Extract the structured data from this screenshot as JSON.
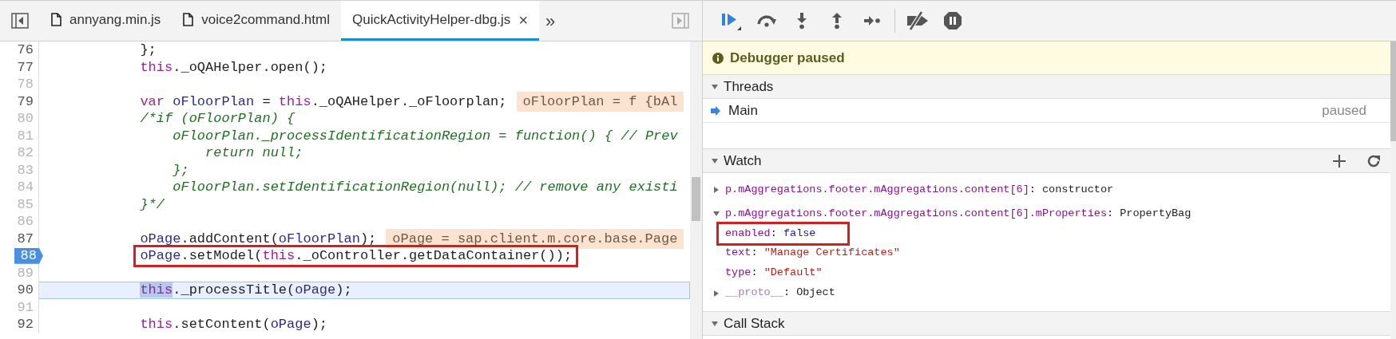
{
  "tabs": [
    {
      "label": "annyang.min.js",
      "selected": false,
      "closable": false
    },
    {
      "label": "voice2command.html",
      "selected": false,
      "closable": false
    },
    {
      "label": "QuickActivityHelper-dbg.js",
      "selected": true,
      "closable": true
    }
  ],
  "close_glyph": "×",
  "overflow_glyph": "»",
  "code_lines": [
    {
      "number": "76",
      "executable": true,
      "current": false,
      "selected": false,
      "annotated": false,
      "tokens": [
        {
          "text": "            };",
          "kind": "plain"
        }
      ]
    },
    {
      "number": "77",
      "executable": true,
      "current": false,
      "selected": false,
      "annotated": false,
      "tokens": [
        {
          "text": "            this",
          "kind": "keyword"
        },
        {
          "text": "._oQAHelper.open();",
          "kind": "plain"
        }
      ]
    },
    {
      "number": "78",
      "executable": false,
      "current": false,
      "selected": false,
      "annotated": false
    },
    {
      "number": "79",
      "executable": true,
      "current": false,
      "selected": false,
      "annotated": false,
      "tokens": [
        {
          "text": "            var",
          "kind": "keyword"
        },
        {
          "text": " oFloorPlan",
          "kind": "variable"
        },
        {
          "text": " = ",
          "kind": "plain"
        },
        {
          "text": "this",
          "kind": "keyword"
        },
        {
          "text": "._oQAHelper._oFloorplan;",
          "kind": "plain"
        }
      ],
      "inline_value": "oFloorPlan = f {bAl"
    },
    {
      "number": "80",
      "executable": false,
      "current": false,
      "selected": false,
      "annotated": false,
      "tokens": [
        {
          "text": "            /*if (oFloorPlan) {",
          "kind": "comment"
        }
      ]
    },
    {
      "number": "81",
      "executable": false,
      "current": false,
      "selected": false,
      "annotated": false,
      "tokens": [
        {
          "text": "                oFloorPlan._processIdentificationRegion = function() { // Prev",
          "kind": "comment"
        }
      ]
    },
    {
      "number": "82",
      "executable": false,
      "current": false,
      "selected": false,
      "annotated": false,
      "tokens": [
        {
          "text": "                    return null;",
          "kind": "comment"
        }
      ]
    },
    {
      "number": "83",
      "executable": false,
      "current": false,
      "selected": false,
      "annotated": false,
      "tokens": [
        {
          "text": "                };",
          "kind": "comment"
        }
      ]
    },
    {
      "number": "84",
      "executable": false,
      "current": false,
      "selected": false,
      "annotated": false,
      "tokens": [
        {
          "text": "                oFloorPlan.setIdentificationRegion(null); // remove any existi",
          "kind": "comment"
        }
      ]
    },
    {
      "number": "85",
      "executable": false,
      "current": false,
      "selected": false,
      "annotated": false,
      "tokens": [
        {
          "text": "            }*/",
          "kind": "comment"
        }
      ]
    },
    {
      "number": "86",
      "executable": false,
      "current": false,
      "selected": false,
      "annotated": false
    },
    {
      "number": "87",
      "executable": true,
      "current": false,
      "selected": false,
      "annotated": false,
      "tokens": [
        {
          "text": "            oPage",
          "kind": "variable"
        },
        {
          "text": ".addContent(",
          "kind": "plain"
        },
        {
          "text": "oFloorPlan",
          "kind": "variable"
        },
        {
          "text": ");",
          "kind": "plain"
        }
      ],
      "inline_value": "oPage = sap.client.m.core.base.Page"
    },
    {
      "number": "88",
      "executable": true,
      "current": true,
      "selected": false,
      "annotated": true,
      "tokens": [
        {
          "text": "oPage",
          "kind": "variable"
        },
        {
          "text": ".setModel(",
          "kind": "plain"
        },
        {
          "text": "this",
          "kind": "keyword"
        },
        {
          "text": "._oController.getDataContainer());",
          "kind": "plain"
        }
      ]
    },
    {
      "number": "89",
      "executable": false,
      "current": false,
      "selected": false,
      "annotated": false
    },
    {
      "number": "90",
      "executable": true,
      "current": false,
      "selected": true,
      "annotated": false,
      "tokens": [
        {
          "text": "this",
          "kind": "selection"
        },
        {
          "text": "._processTitle(",
          "kind": "plain"
        },
        {
          "text": "oPage",
          "kind": "variable"
        },
        {
          "text": ");",
          "kind": "plain"
        }
      ]
    },
    {
      "number": "91",
      "executable": false,
      "current": false,
      "selected": false,
      "annotated": false
    },
    {
      "number": "92",
      "executable": true,
      "current": false,
      "selected": false,
      "annotated": false,
      "tokens": [
        {
          "text": "            this",
          "kind": "keyword"
        },
        {
          "text": ".setContent(",
          "kind": "plain"
        },
        {
          "text": "oPage",
          "kind": "variable"
        },
        {
          "text": ");",
          "kind": "plain"
        }
      ]
    }
  ],
  "banner": "Debugger paused",
  "threads": {
    "title": "Threads",
    "expanded": true,
    "items": [
      {
        "name": "Main",
        "status": "paused",
        "current": true
      }
    ]
  },
  "watch": {
    "title": "Watch",
    "expanded": true,
    "separator": ":",
    "entries": [
      {
        "name": "p.mAggregations.footer.mAggregations.content[6]",
        "value": "constructor",
        "expanded": false
      },
      {
        "name": "p.mAggregations.footer.mAggregations.content[6].mProperties",
        "value": "PropertyBag",
        "expanded": true,
        "children": [
          {
            "name": "enabled",
            "value": "false",
            "kind": "boolean",
            "annotated": true
          },
          {
            "name": "text",
            "value": "\"Manage Certificates\"",
            "kind": "string",
            "annotated": false
          },
          {
            "name": "type",
            "value": "\"Default\"",
            "kind": "string",
            "annotated": false
          },
          {
            "name": "__proto__",
            "value": "Object",
            "kind": "object",
            "annotated": false,
            "internal": true
          }
        ]
      }
    ]
  },
  "call_stack": {
    "title": "Call Stack",
    "expanded": true
  }
}
